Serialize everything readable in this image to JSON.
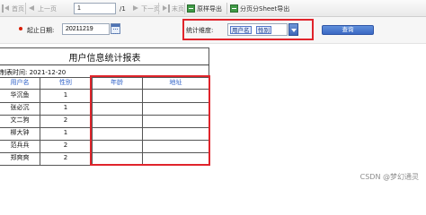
{
  "toolbar": {
    "first_label": "首页",
    "prev_label": "上一页",
    "page_value": "1",
    "total_pages": "/1",
    "next_label": "下一页",
    "last_label": "末页",
    "export_label": "原样导出",
    "sheet_export_label": "分页分Sheet导出"
  },
  "filter": {
    "start_date_label": "起止日期:",
    "start_date_value": "20211219",
    "dimension_label": "统计维度:",
    "dimension_tags": [
      "用户名",
      "性别"
    ],
    "query_label": "查询"
  },
  "report": {
    "title": "用户信息统计报表",
    "date_label": "制表时间: 2021-12-20",
    "headers": [
      "用户名",
      "性别",
      "年龄",
      "地址"
    ],
    "rows": [
      [
        "华沉鱼",
        "1",
        "",
        ""
      ],
      [
        "张必沉",
        "1",
        "",
        ""
      ],
      [
        "文二狗",
        "2",
        "",
        ""
      ],
      [
        "柳大钟",
        "1",
        "",
        ""
      ],
      [
        "范兵兵",
        "2",
        "",
        ""
      ],
      [
        "郑爽爽",
        "2",
        "",
        ""
      ]
    ]
  },
  "watermark": "CSDN @梦幻通灵",
  "colors": {
    "highlight": "#e0242b",
    "header_text": "#2f62c8",
    "accent": "#3b68c3"
  }
}
